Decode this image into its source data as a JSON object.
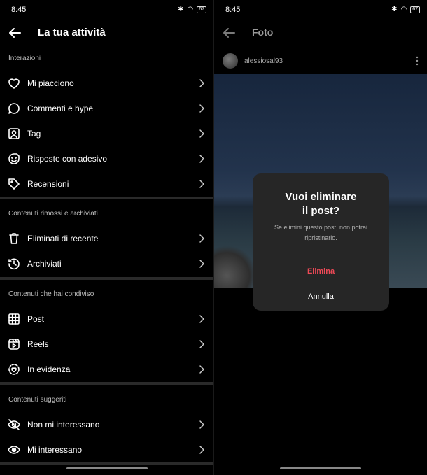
{
  "left": {
    "status_time": "8:45",
    "battery": "67",
    "title": "La tua attività",
    "sections": [
      {
        "label": "Interazioni",
        "items": [
          {
            "label": "Mi piacciono",
            "icon": "heart-icon"
          },
          {
            "label": "Commenti e hype",
            "icon": "comment-icon"
          },
          {
            "label": "Tag",
            "icon": "tag-person-icon"
          },
          {
            "label": "Risposte con adesivo",
            "icon": "sticker-icon"
          },
          {
            "label": "Recensioni",
            "icon": "price-tag-icon"
          }
        ]
      },
      {
        "label": "Contenuti rimossi e archiviati",
        "items": [
          {
            "label": "Eliminati di recente",
            "icon": "trash-icon"
          },
          {
            "label": "Archiviati",
            "icon": "archive-icon"
          }
        ]
      },
      {
        "label": "Contenuti che hai condiviso",
        "items": [
          {
            "label": "Post",
            "icon": "grid-icon"
          },
          {
            "label": "Reels",
            "icon": "reels-icon"
          },
          {
            "label": "In evidenza",
            "icon": "highlight-icon"
          }
        ]
      },
      {
        "label": "Contenuti suggeriti",
        "items": [
          {
            "label": "Non mi interessano",
            "icon": "eye-off-icon"
          },
          {
            "label": "Mi interessano",
            "icon": "eye-icon"
          }
        ]
      }
    ]
  },
  "right": {
    "status_time": "8:45",
    "battery": "67",
    "title": "Foto",
    "username": "alessiosal93",
    "dialog": {
      "title_line1": "Vuoi eliminare",
      "title_line2": "il post?",
      "message": "Se elimini questo post, non potrai ripristinarlo.",
      "delete_label": "Elimina",
      "cancel_label": "Annulla"
    }
  },
  "colors": {
    "background": "#000000",
    "danger": "#ed4956",
    "dialog": "#262626"
  }
}
